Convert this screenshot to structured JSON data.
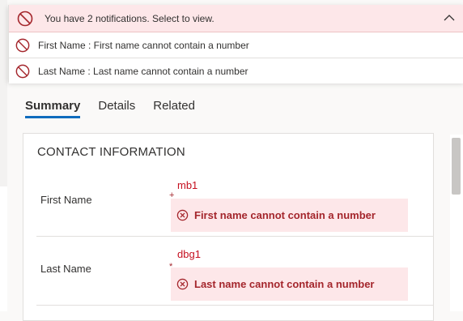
{
  "notifications": {
    "header_text": "You have 2 notifications. Select to view.",
    "items": [
      {
        "text": "First Name : First name cannot contain a number"
      },
      {
        "text": "Last Name : Last name cannot contain a number"
      }
    ]
  },
  "tabs": [
    {
      "label": "Summary",
      "active": true
    },
    {
      "label": "Details",
      "active": false
    },
    {
      "label": "Related",
      "active": false
    }
  ],
  "section": {
    "title": "CONTACT INFORMATION",
    "fields": [
      {
        "label": "First Name",
        "required_marker": "+",
        "value": "mb1",
        "error": "First name cannot contain a number"
      },
      {
        "label": "Last Name",
        "required_marker": "*",
        "value": "dbg1",
        "error": "Last name cannot contain a number"
      }
    ]
  },
  "colors": {
    "error_red": "#a4262c",
    "error_bg": "#fde7e9",
    "accent_blue": "#0f6cbd"
  },
  "icons": {
    "blocked": "blocked-circle-icon",
    "collapse": "chevron-up-icon",
    "error": "error-circle-icon"
  }
}
